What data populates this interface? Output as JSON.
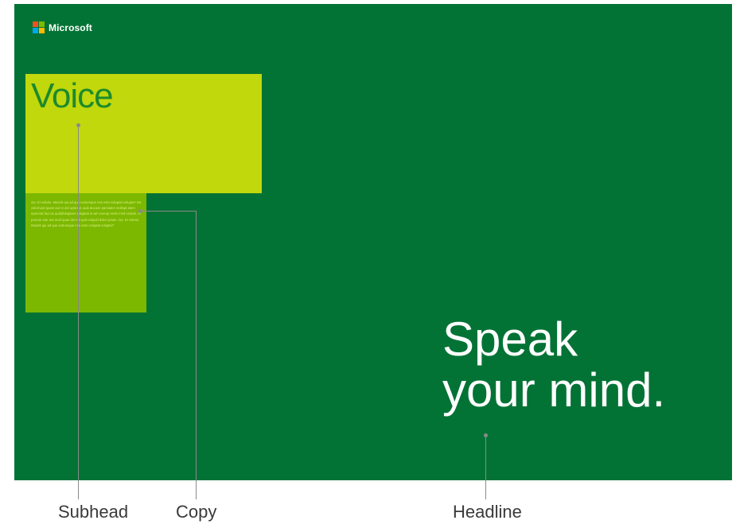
{
  "poster": {
    "brand": "Microsoft",
    "brand_colors": [
      "#f25022",
      "#7fba00",
      "#00a4ef",
      "#ffb900"
    ],
    "background_color": "#037335",
    "subhead": "Voice",
    "copy": "Ga. Et volorio. Maiorit qui ad que extrumque nos esto voluptat volupta? Da volorruod quam aut re dol upta tur, quis ducuse parciates mollupt atem eperorat faccus quidebitupiam voluptati ut am exerup endo mod endam, si porrum etur aut mod quas del mo quis ratquid dolor ipsum. Ga. Et volorio. Maiorit qui ad que extrumque nos esto voluptat volupta?",
    "headline_line1": "Speak",
    "headline_line2": "your mind."
  },
  "labels": {
    "subhead": "Subhead",
    "copy": "Copy",
    "headline": "Headline"
  }
}
